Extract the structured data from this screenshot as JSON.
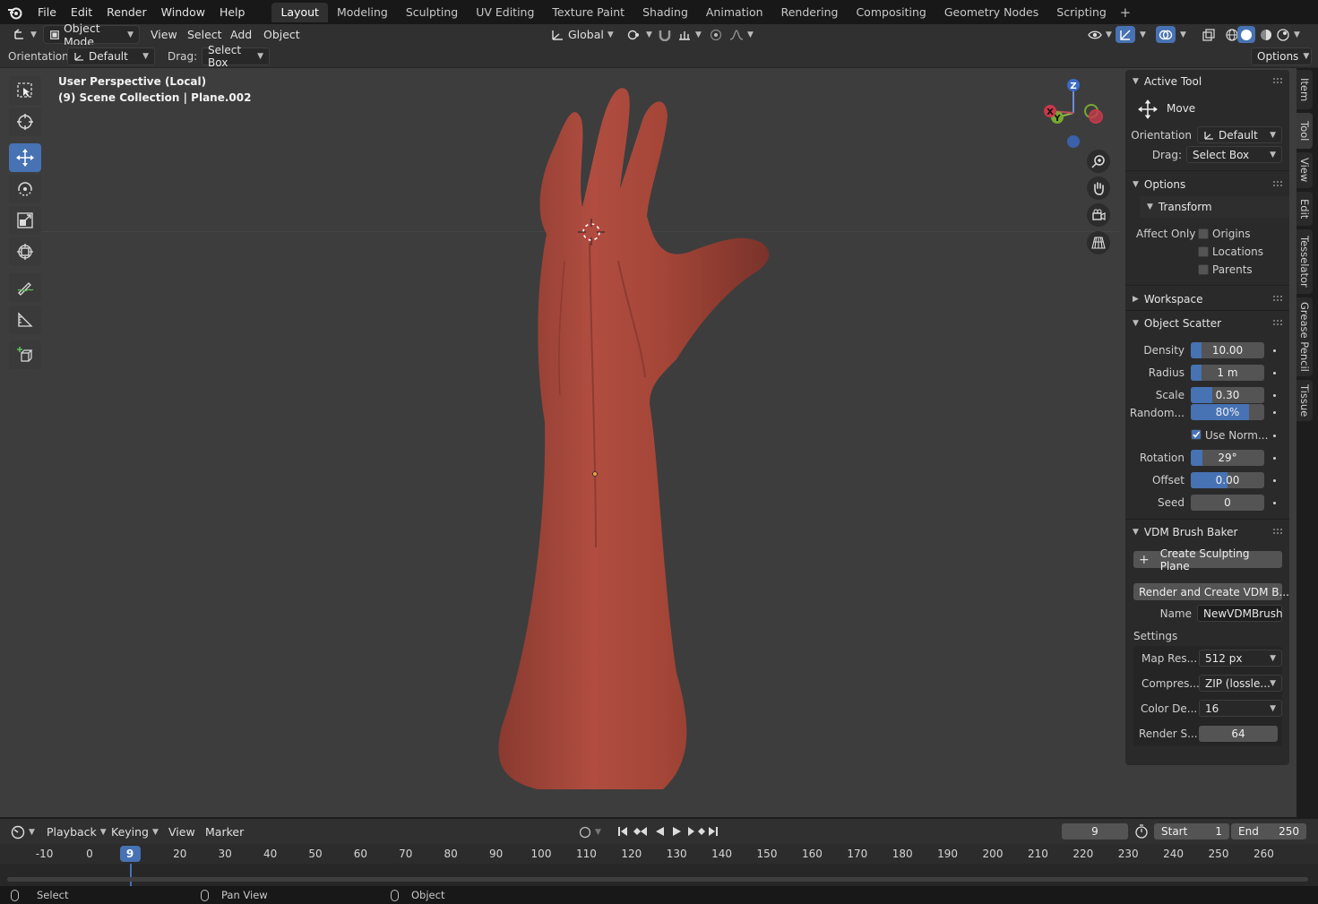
{
  "menu": {
    "items": [
      "File",
      "Edit",
      "Render",
      "Window",
      "Help"
    ],
    "workspaces": [
      "Layout",
      "Modeling",
      "Sculpting",
      "UV Editing",
      "Texture Paint",
      "Shading",
      "Animation",
      "Rendering",
      "Compositing",
      "Geometry Nodes",
      "Scripting"
    ],
    "active_workspace": "Layout",
    "add_symbol": "+"
  },
  "viewport_header": {
    "mode": "Object Mode",
    "menus": [
      "View",
      "Select",
      "Add",
      "Object"
    ],
    "transform_orientation": "Global"
  },
  "tool_header": {
    "orientation_label": "Orientation:",
    "orientation_value": "Default",
    "drag_label": "Drag:",
    "drag_value": "Select Box",
    "options_label": "Options"
  },
  "viewport": {
    "perspective": "User Perspective (Local)",
    "collection": "(9) Scene Collection | Plane.002",
    "gizmo_axes": {
      "z": "Z",
      "y": "Y",
      "x": "X"
    }
  },
  "npanel": {
    "active_tool": {
      "title": "Active Tool",
      "tool_name": "Move",
      "orientation_label": "Orientation",
      "orientation_value": "Default",
      "drag_label": "Drag:",
      "drag_value": "Select Box"
    },
    "options": {
      "title": "Options",
      "transform": "Transform",
      "affect_only": "Affect Only",
      "origins": "Origins",
      "locations": "Locations",
      "parents": "Parents"
    },
    "workspace": {
      "title": "Workspace"
    },
    "object_scatter": {
      "title": "Object Scatter",
      "density_label": "Density",
      "density": "10.00",
      "radius_label": "Radius",
      "radius": "1 m",
      "scale_label": "Scale",
      "scale": "0.30",
      "random_label": "Random...",
      "random": "80%",
      "use_normal": "Use Norm...",
      "rotation_label": "Rotation",
      "rotation": "29°",
      "offset_label": "Offset",
      "offset": "0.00",
      "seed_label": "Seed",
      "seed": "0"
    },
    "vdm": {
      "title": "VDM Brush Baker",
      "create_plane": "Create Sculpting Plane",
      "render_create": "Render and Create VDM B...",
      "name_label": "Name",
      "name_value": "NewVDMBrush",
      "settings": "Settings",
      "map_res_label": "Map Res...",
      "map_res": "512 px",
      "compress_label": "Compres...",
      "compress": "ZIP (lossle...",
      "color_depth_label": "Color De...",
      "color_depth": "16",
      "render_samples_label": "Render S...",
      "render_samples": "64"
    }
  },
  "side_tabs": [
    "Item",
    "Tool",
    "View",
    "Edit",
    "Tesselator",
    "Grease Pencil",
    "Tissue"
  ],
  "timeline": {
    "menus": [
      "Playback",
      "Keying",
      "View",
      "Marker"
    ],
    "current_frame": "9",
    "start_label": "Start",
    "start": "1",
    "end_label": "End",
    "end": "250",
    "frame_labels": [
      "-10",
      "0",
      "9",
      "20",
      "30",
      "40",
      "50",
      "60",
      "70",
      "80",
      "90",
      "100",
      "110",
      "120",
      "130",
      "140",
      "150",
      "160",
      "170",
      "180",
      "190",
      "200",
      "210",
      "220",
      "230",
      "240",
      "250",
      "260"
    ]
  },
  "statusbar": {
    "select": "Select",
    "pan": "Pan View",
    "object": "Object"
  }
}
